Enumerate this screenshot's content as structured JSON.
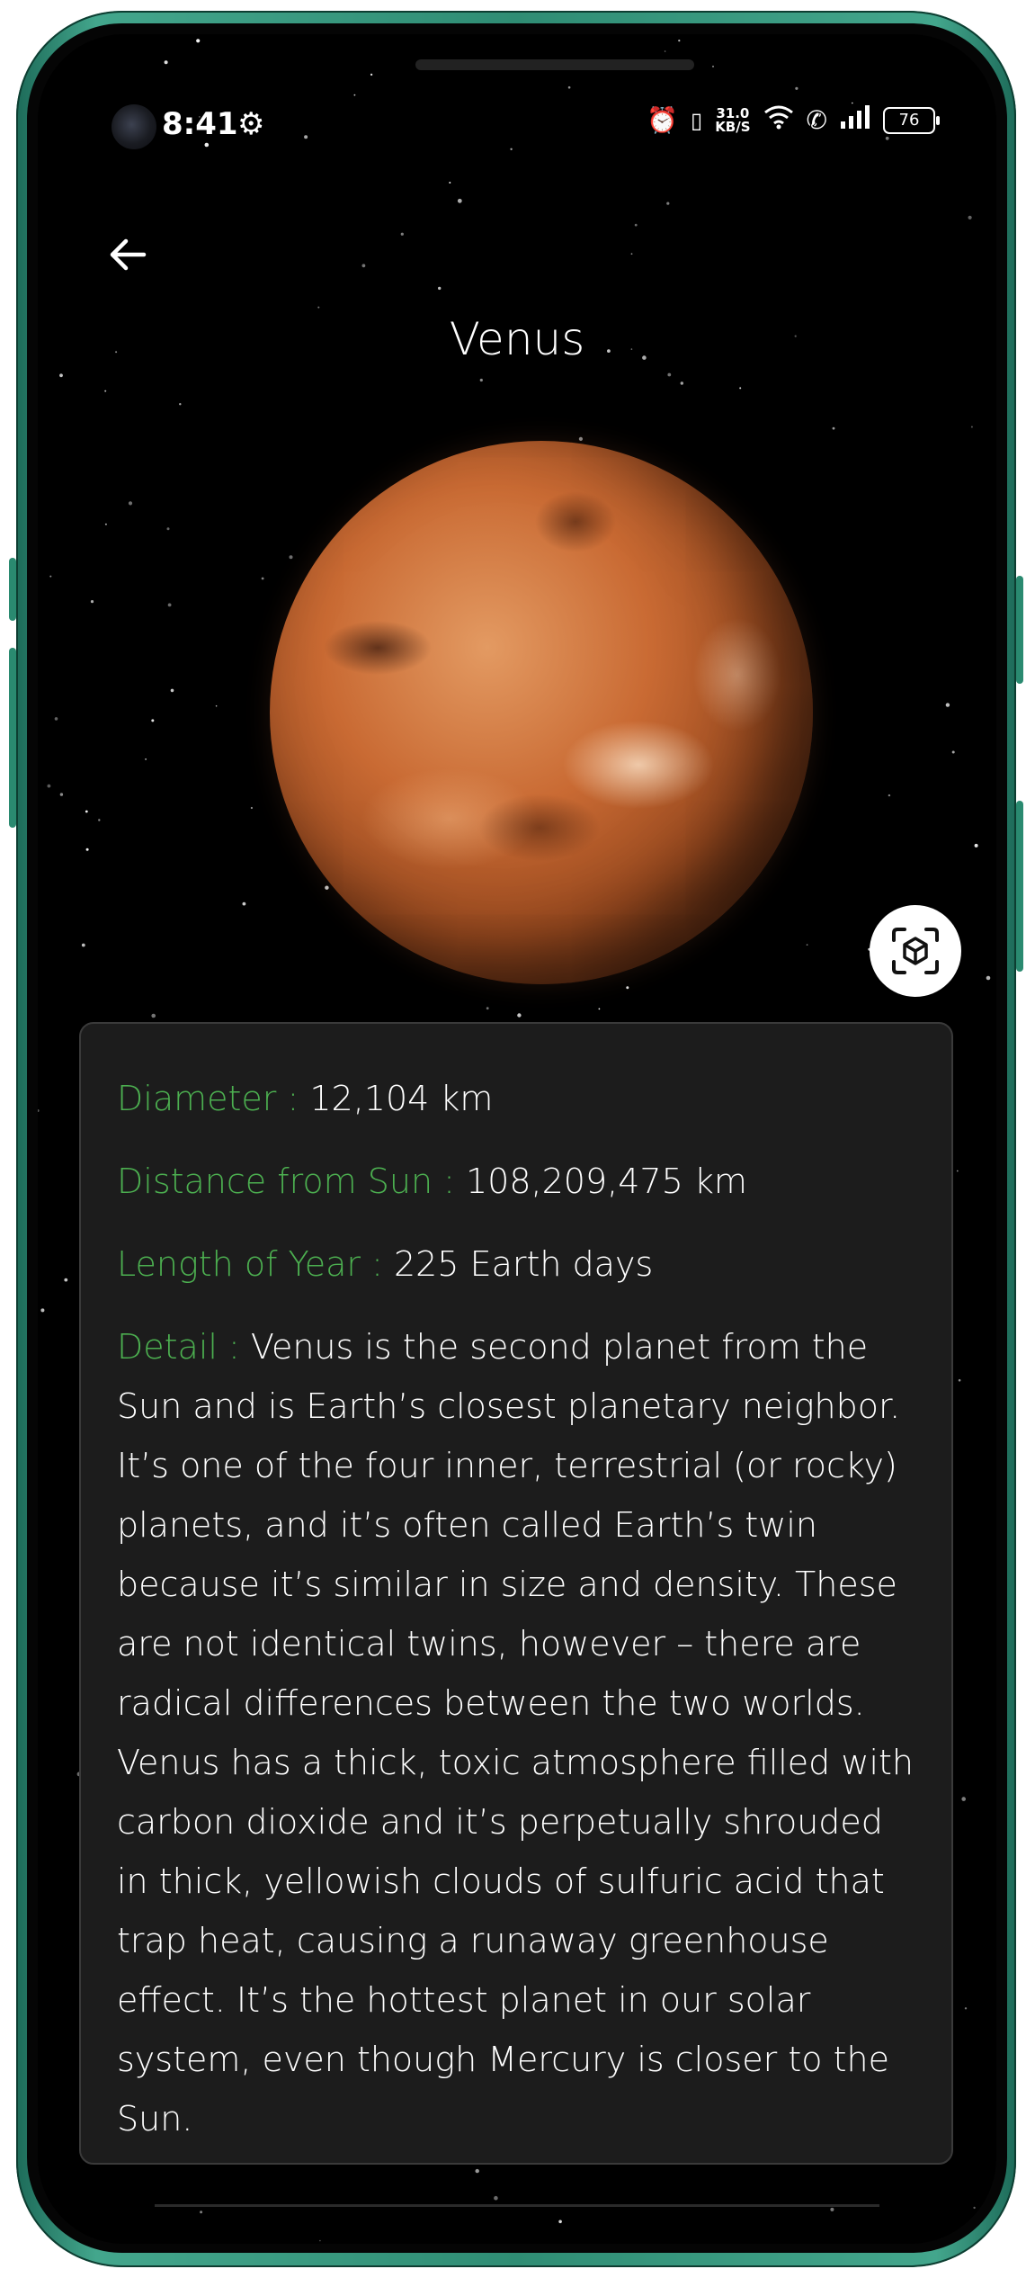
{
  "status_bar": {
    "time": "8:41",
    "network_speed_value": "31.0",
    "network_speed_unit": "KB/S",
    "battery": "76"
  },
  "header": {
    "back_icon": "arrow-left-icon",
    "title": "Venus"
  },
  "planet": {
    "ar_icon": "view-in-ar-icon"
  },
  "info": {
    "diameter_label": "Diameter : ",
    "diameter_value": "12,104 km",
    "distance_label": "Distance from Sun : ",
    "distance_value": "108,209,475 km",
    "year_label": "Length of Year : ",
    "year_value": "225 Earth days",
    "detail_label": "Detail : ",
    "detail_value": "Venus is the second planet from the Sun and is Earth’s closest planetary neighbor. It’s one of the four inner, terrestrial (or rocky) planets, and it’s often called Earth’s twin because it’s similar in size and density. These are not identical twins, however – there are radical differences between the two worlds. Venus has a thick, toxic atmosphere filled with carbon dioxide and it’s perpetually shrouded in thick, yellowish clouds of sulfuric acid that trap heat, causing a runaway greenhouse effect. It’s the hottest planet in our solar system, even though Mercury is closer to the Sun."
  },
  "colors": {
    "label_green": "#4caf50",
    "background": "#000000",
    "card": "#1c1c1c"
  }
}
